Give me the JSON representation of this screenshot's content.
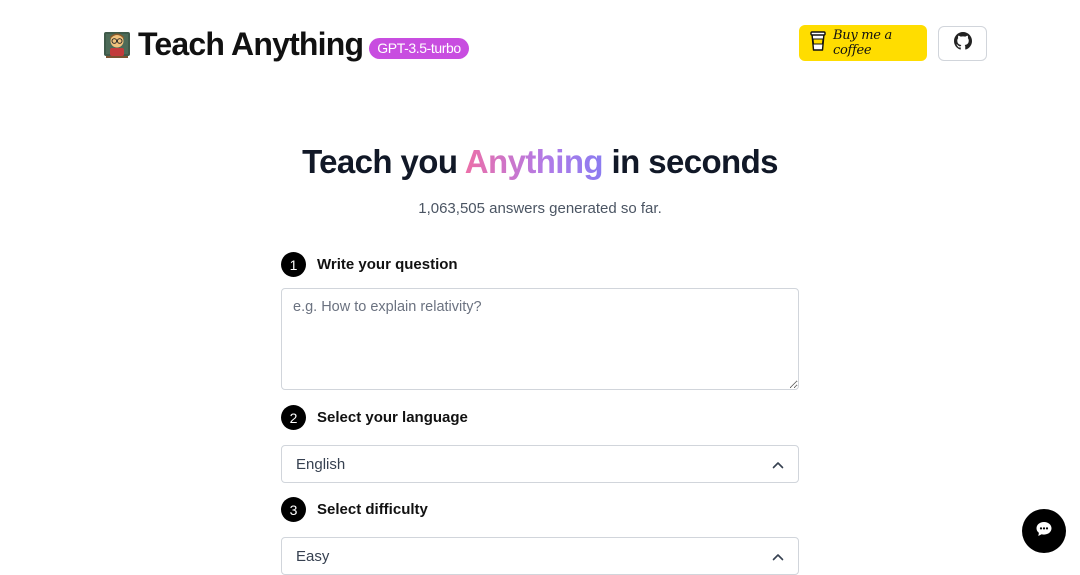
{
  "header": {
    "brand_title": "Teach Anything",
    "model_badge": "GPT-3.5-turbo",
    "coffee_label": "Buy me a coffee",
    "icons": {
      "avatar": "teacher-emoji-icon",
      "coffee": "coffee-cup-icon",
      "github": "github-icon"
    }
  },
  "hero": {
    "title_prefix": "Teach you ",
    "title_accent": "Anything",
    "title_suffix": " in seconds",
    "counter": "1,063,505 answers generated so far."
  },
  "form": {
    "step1": {
      "number": "1",
      "label": "Write your question",
      "placeholder": "e.g. How to explain relativity?",
      "value": ""
    },
    "step2": {
      "number": "2",
      "label": "Select your language",
      "value": "English"
    },
    "step3": {
      "number": "3",
      "label": "Select difficulty",
      "value": "Easy"
    }
  },
  "chat": {
    "icon": "chat-bubble-icon"
  },
  "colors": {
    "badge": "#c84de0",
    "coffee_bg": "#ffdd00",
    "accent_gradient_start": "#ec6fa8",
    "accent_gradient_end": "#8b7cf0"
  }
}
